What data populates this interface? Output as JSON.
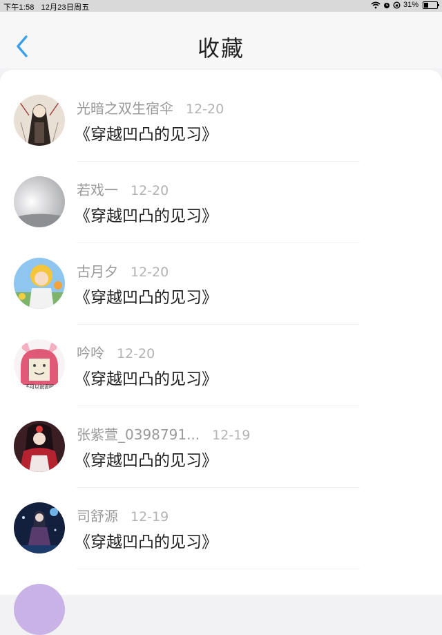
{
  "status": {
    "time": "下午1:58",
    "date": "12月23日周五",
    "battery": "31%",
    "battery_level": 0.31
  },
  "header": {
    "title": "收藏"
  },
  "items": [
    {
      "name": "光暗之双生宿伞",
      "date": "12-20",
      "book": "《穿越凹凸的见习》"
    },
    {
      "name": "若戏一",
      "date": "12-20",
      "book": "《穿越凹凸的见习》"
    },
    {
      "name": "古月夕",
      "date": "12-20",
      "book": "《穿越凹凸的见习》"
    },
    {
      "name": "吟呤",
      "date": "12-20",
      "book": "《穿越凹凸的见习》"
    },
    {
      "name": "张紫萱_0398791...",
      "date": "12-19",
      "book": "《穿越凹凸的见习》"
    },
    {
      "name": "司舒源",
      "date": "12-19",
      "book": "《穿越凹凸的见习》"
    }
  ],
  "avatar_meme_text": "不可以说谎噢"
}
